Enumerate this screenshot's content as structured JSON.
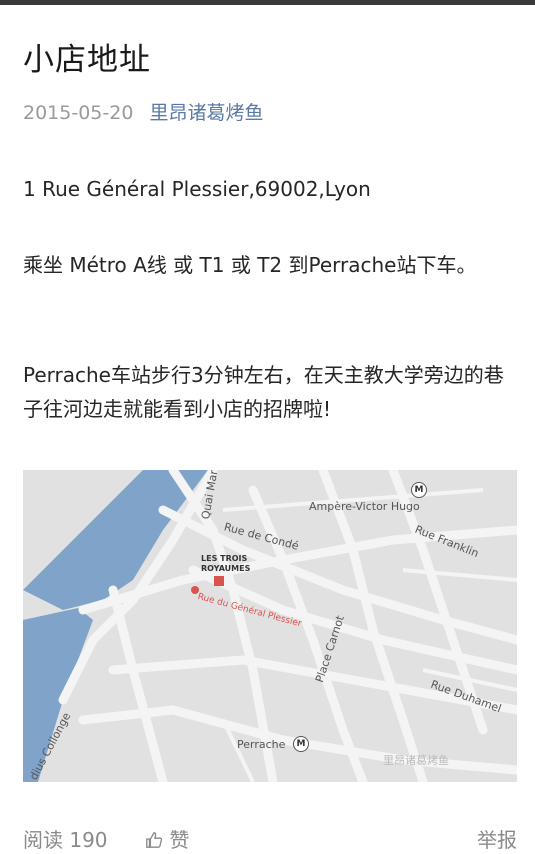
{
  "article": {
    "title": "小店地址",
    "date": "2015-05-20",
    "account_name": "里昂诸葛烤鱼",
    "address": "1 Rue Général Plessier,69002,Lyon",
    "transit": "乘坐 Métro A线 或 T1 或 T2 到Perrache站下车。",
    "directions": "Perrache车站步行3分钟左右，在天主教大学旁边的巷子往河边走就能看到小店的招牌啦!"
  },
  "map": {
    "labels": {
      "quai_maree": "Quai Marée",
      "ampere": "Ampère-Victor Hugo",
      "rue_conde": "Rue de Condé",
      "rue_franklin": "Rue Franklin",
      "shop_logo": "LES TROIS ROYAUMES",
      "rue_plessier": "Rue du Général Plessier",
      "place_carnot": "Place Carnot",
      "rue_duhamel": "Rue Duhamel",
      "perrache": "Perrache",
      "colonge": "dius Collonge",
      "metro_symbol": "M",
      "watermark": "里昂诸葛烤鱼"
    },
    "colors": {
      "river": "#7fa3c9",
      "street": "#f4f4f4",
      "block": "#e1e1e1",
      "marker": "#d9534f"
    }
  },
  "footer": {
    "reads": "阅读 190",
    "like": "赞",
    "report": "举报"
  }
}
